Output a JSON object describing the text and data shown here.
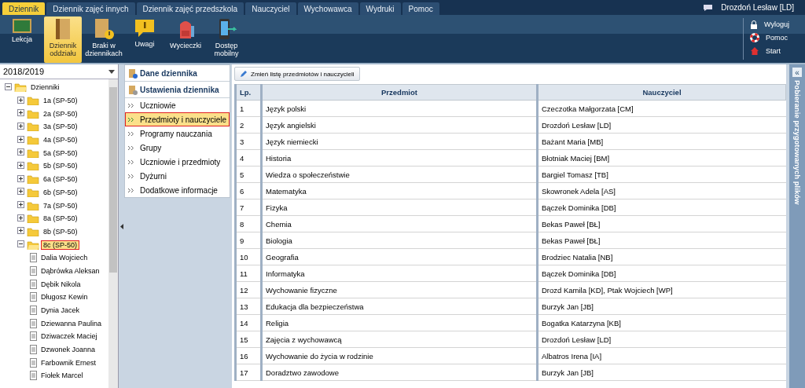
{
  "menu_tabs": [
    {
      "label": "Dziennik",
      "selected": true
    },
    {
      "label": "Dziennik zajęć innych",
      "selected": false
    },
    {
      "label": "Dziennik zajęć przedszkola",
      "selected": false
    },
    {
      "label": "Nauczyciel",
      "selected": false
    },
    {
      "label": "Wychowawca",
      "selected": false
    },
    {
      "label": "Wydruki",
      "selected": false
    },
    {
      "label": "Pomoc",
      "selected": false
    }
  ],
  "user": "Drozdoń Lesław [LD]",
  "ribbon": [
    {
      "kind": "board",
      "label": "Lekcja",
      "selected": false
    },
    {
      "kind": "book",
      "label": "Dziennik oddziału",
      "selected": true
    },
    {
      "kind": "warning-book",
      "label": "Braki w dziennikach",
      "selected": false
    },
    {
      "kind": "note",
      "label": "Uwagi",
      "selected": false
    },
    {
      "kind": "backpack",
      "label": "Wycieczki",
      "selected": false
    },
    {
      "kind": "phone",
      "label": "Dostęp mobilny",
      "selected": false
    }
  ],
  "account_links": [
    {
      "kind": "lock",
      "label": "Wyloguj"
    },
    {
      "kind": "lifebuoy",
      "label": "Pomoc"
    },
    {
      "kind": "home",
      "label": "Start"
    }
  ],
  "year": "2018/2019",
  "tree": [
    {
      "label": "Dzienniki",
      "kind": "folder",
      "expanded": true,
      "selected": false,
      "children": [
        {
          "label": "1a (SP-50)",
          "kind": "folder",
          "expanded": false,
          "selected": false
        },
        {
          "label": "2a (SP-50)",
          "kind": "folder",
          "expanded": false,
          "selected": false
        },
        {
          "label": "3a (SP-50)",
          "kind": "folder",
          "expanded": false,
          "selected": false
        },
        {
          "label": "4a (SP-50)",
          "kind": "folder",
          "expanded": false,
          "selected": false
        },
        {
          "label": "5a (SP-50)",
          "kind": "folder",
          "expanded": false,
          "selected": false
        },
        {
          "label": "5b (SP-50)",
          "kind": "folder",
          "expanded": false,
          "selected": false
        },
        {
          "label": "6a (SP-50)",
          "kind": "folder",
          "expanded": false,
          "selected": false
        },
        {
          "label": "6b (SP-50)",
          "kind": "folder",
          "expanded": false,
          "selected": false
        },
        {
          "label": "7a (SP-50)",
          "kind": "folder",
          "expanded": false,
          "selected": false
        },
        {
          "label": "8a (SP-50)",
          "kind": "folder",
          "expanded": false,
          "selected": false
        },
        {
          "label": "8b (SP-50)",
          "kind": "folder",
          "expanded": false,
          "selected": false
        },
        {
          "label": "8c (SP-50)",
          "kind": "folder",
          "expanded": true,
          "selected": true,
          "children": [
            {
              "label": "Dalia Wojciech",
              "kind": "file",
              "selected": false
            },
            {
              "label": "Dąbrówka Aleksan",
              "kind": "file",
              "selected": false
            },
            {
              "label": "Dębik Nikola",
              "kind": "file",
              "selected": false
            },
            {
              "label": "Długosz Kewin",
              "kind": "file",
              "selected": false
            },
            {
              "label": "Dynia Jacek",
              "kind": "file",
              "selected": false
            },
            {
              "label": "Dziewanna Paulina",
              "kind": "file",
              "selected": false
            },
            {
              "label": "Dziwaczek Maciej",
              "kind": "file",
              "selected": false
            },
            {
              "label": "Dzwonek Joanna",
              "kind": "file",
              "selected": false
            },
            {
              "label": "Farbownik Ernest",
              "kind": "file",
              "selected": false
            },
            {
              "label": "Fiołek Marcel",
              "kind": "file",
              "selected": false
            }
          ]
        }
      ]
    }
  ],
  "nav": {
    "sections": [
      {
        "kind": "info",
        "title": "Dane dziennika"
      },
      {
        "kind": "settings",
        "title": "Ustawienia dziennika"
      }
    ],
    "items": [
      {
        "label": "Uczniowie",
        "selected": false
      },
      {
        "label": "Przedmioty i nauczyciele",
        "selected": true
      },
      {
        "label": "Programy nauczania",
        "selected": false
      },
      {
        "label": "Grupy",
        "selected": false
      },
      {
        "label": "Uczniowie i przedmioty",
        "selected": false
      },
      {
        "label": "Dyżurni",
        "selected": false
      },
      {
        "label": "Dodatkowe informacje",
        "selected": false
      }
    ]
  },
  "toolbar_button": "Zmień listę przedmiotów i nauczycieli",
  "table": {
    "columns": [
      "Lp.",
      "Przedmiot",
      "Nauczyciel"
    ],
    "rows": [
      [
        "1",
        "Język polski",
        "Czeczotka Małgorzata [CM]"
      ],
      [
        "2",
        "Język angielski",
        "Drozdoń Lesław [LD]"
      ],
      [
        "3",
        "Język niemiecki",
        "Bażant Maria [MB]"
      ],
      [
        "4",
        "Historia",
        "Błotniak Maciej [BM]"
      ],
      [
        "5",
        "Wiedza o społeczeństwie",
        "Bargiel Tomasz [TB]"
      ],
      [
        "6",
        "Matematyka",
        "Skowronek Adela [AS]"
      ],
      [
        "7",
        "Fizyka",
        "Bączek Dominika [DB]"
      ],
      [
        "8",
        "Chemia",
        "Bekas Paweł [BŁ]"
      ],
      [
        "9",
        "Biologia",
        "Bekas Paweł [BŁ]"
      ],
      [
        "10",
        "Geografia",
        "Brodziec Natalia [NB]"
      ],
      [
        "11",
        "Informatyka",
        "Bączek Dominika [DB]"
      ],
      [
        "12",
        "Wychowanie fizyczne",
        "Drozd Kamila [KD], Ptak Wojciech [WP]"
      ],
      [
        "13",
        "Edukacja dla bezpieczeństwa",
        "Burzyk Jan [JB]"
      ],
      [
        "14",
        "Religia",
        "Bogatka Katarzyna [KB]"
      ],
      [
        "15",
        "Zajęcia z wychowawcą",
        "Drozdoń Lesław [LD]"
      ],
      [
        "16",
        "Wychowanie do życia w rodzinie",
        "Albatros Irena [IA]"
      ],
      [
        "17",
        "Doradztwo zawodowe",
        "Burzyk Jan [JB]"
      ]
    ]
  },
  "side_panel": {
    "title": "Pobieranie przygotowanych plików",
    "expand_icon": "«"
  }
}
